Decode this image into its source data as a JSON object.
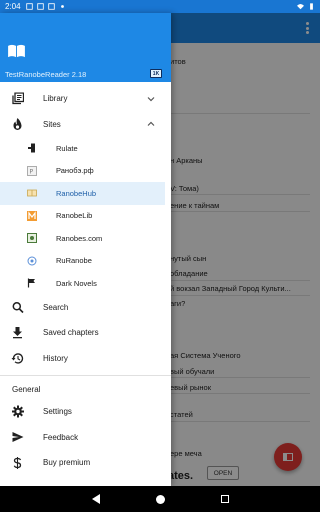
{
  "status_bar": {
    "time": "2:04"
  },
  "drawer": {
    "app_name": "TestRanobeReader 2.18",
    "badge": "1K",
    "primary": [
      {
        "label": "Library",
        "icon": "library-icon",
        "chevron": "down"
      },
      {
        "label": "Sites",
        "icon": "fire-icon",
        "chevron": "up"
      }
    ],
    "sites": [
      {
        "label": "Rulate",
        "icon": "rulate-icon",
        "active": false
      },
      {
        "label": "Ранобэ.рф",
        "icon": "ranobe-rf-icon",
        "active": false
      },
      {
        "label": "RanobeHub",
        "icon": "ranobehub-icon",
        "active": true
      },
      {
        "label": "RanobeLib",
        "icon": "ranobelib-icon",
        "active": false
      },
      {
        "label": "Ranobes.com",
        "icon": "ranobes-icon",
        "active": false
      },
      {
        "label": "RuRanobe",
        "icon": "ruranobe-icon",
        "active": false
      },
      {
        "label": "Dark Novels",
        "icon": "flag-icon",
        "active": false
      }
    ],
    "actions": [
      {
        "label": "Search",
        "icon": "search-icon"
      },
      {
        "label": "Saved chapters",
        "icon": "download-icon"
      },
      {
        "label": "History",
        "icon": "history-icon"
      }
    ],
    "general_header": "General",
    "general": [
      {
        "label": "Settings",
        "icon": "gear-icon"
      },
      {
        "label": "Feedback",
        "icon": "send-icon"
      },
      {
        "label": "Buy premium",
        "icon": "dollar-icon"
      }
    ]
  },
  "background": {
    "lines": [
      "итов",
      "н Арканы",
      "V: Тома)",
      "ение к тайнам",
      "нутый сын",
      "обладание",
      "й вокзал Западный Город Культи...",
      "аги?",
      "ая Система Ученого",
      "вый обучали",
      "евый рынок",
      "статей",
      "ере меча",
      "ates."
    ],
    "open_button": "OPEN"
  },
  "colors": {
    "primary": "#1e88e5",
    "accent": "#e53935",
    "active_bg": "#e3f0fb"
  }
}
